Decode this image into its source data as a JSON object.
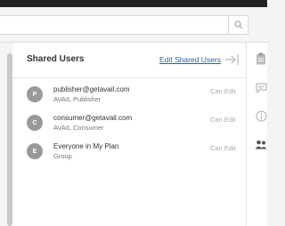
{
  "panel": {
    "title": "Shared Users",
    "edit_link": "Edit Shared Users"
  },
  "users": [
    {
      "initial": "P",
      "name": "publisher@getavail.com",
      "role": "AVAIL Publisher",
      "permission": "Can Edit"
    },
    {
      "initial": "C",
      "name": "consumer@getavail.com",
      "role": "AVAIL Consumer",
      "permission": "Can Edit"
    },
    {
      "initial": "E",
      "name": "Everyone in My Plan",
      "role": "Group",
      "permission": "Can Edit"
    }
  ],
  "icons": {
    "search": "search-icon",
    "collapse": "collapse-panel-icon",
    "sidebar": [
      "clipboard-icon",
      "comment-icon",
      "info-icon",
      "users-icon"
    ]
  },
  "colors": {
    "topbar": "#222222",
    "link": "#2d5f9e",
    "avatar": "#999999",
    "active_icon": "#555555",
    "inactive_icon": "#bbbbbb"
  }
}
